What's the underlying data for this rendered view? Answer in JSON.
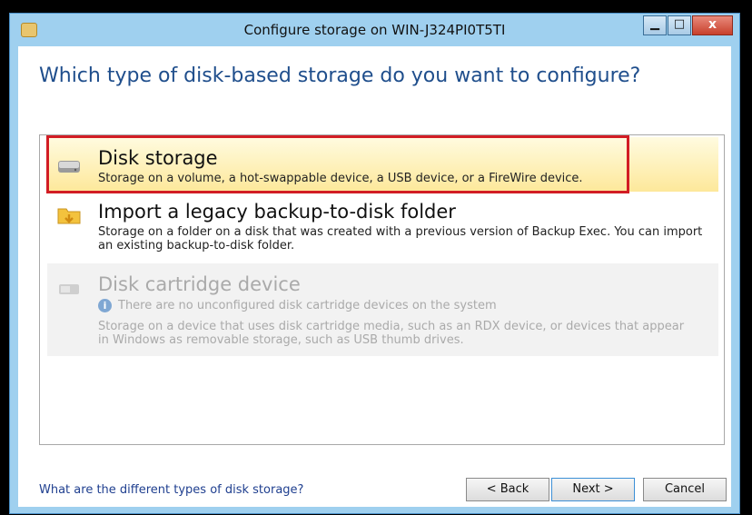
{
  "window": {
    "title": "Configure storage on WIN-J324PI0T5TI",
    "min_glyph": "▁",
    "max_glyph": "□",
    "close_glyph": "x"
  },
  "heading": "Which type of disk-based storage do you want to configure?",
  "options": [
    {
      "title": "Disk storage",
      "description": "Storage on a volume, a hot-swappable device, a USB device, or a FireWire device.",
      "icon": "hard-drive-icon"
    },
    {
      "title": "Import a legacy backup-to-disk folder",
      "description": "Storage on a folder on a disk that was created with a previous version of Backup Exec.  You can import an existing backup-to-disk folder.",
      "icon": "folder-import-icon"
    },
    {
      "title": "Disk cartridge device",
      "info": "There are no unconfigured disk cartridge devices on the system",
      "description": "Storage on a device that uses disk cartridge media, such as an RDX device, or devices that appear in Windows as removable storage, such as USB thumb drives.",
      "icon": "cartridge-icon"
    }
  ],
  "footer": {
    "help_link": "What are the different types of disk storage?",
    "back": "< Back",
    "next": "Next >",
    "cancel": "Cancel"
  },
  "colors": {
    "heading": "#1f4e8c",
    "selection_border": "#d21d24",
    "selected_bg": "#fde89a",
    "disabled_text": "#aaaaaa"
  }
}
